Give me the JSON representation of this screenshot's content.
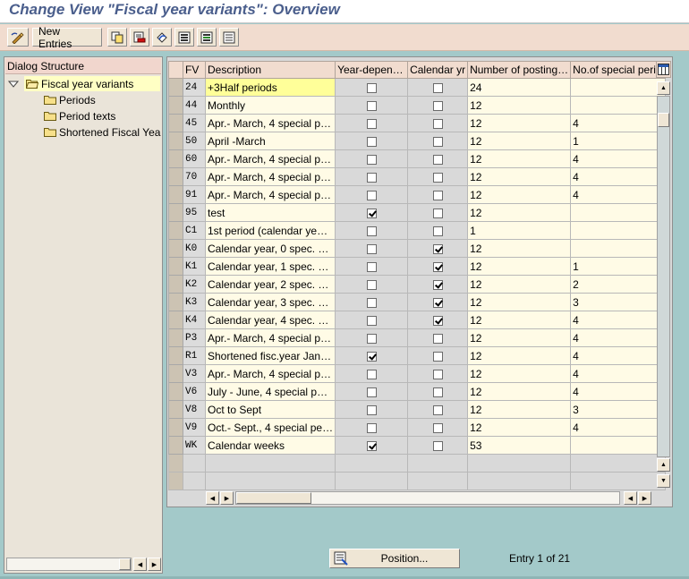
{
  "window": {
    "title": "Change View \"Fiscal year variants\": Overview"
  },
  "toolbar": {
    "buttons": [
      {
        "name": "display-change-icon"
      },
      {
        "name": "new-entries-button",
        "label": "New Entries"
      },
      {
        "name": "copy-icon"
      },
      {
        "name": "delete-icon"
      },
      {
        "name": "undo-icon"
      },
      {
        "name": "select-all-icon"
      },
      {
        "name": "select-block-icon"
      },
      {
        "name": "deselect-all-icon"
      }
    ]
  },
  "dialog_structure": {
    "header": "Dialog Structure",
    "items": [
      {
        "label": "Fiscal year variants",
        "level": 0,
        "selected": true,
        "expanded": true
      },
      {
        "label": "Periods",
        "level": 1
      },
      {
        "label": "Period texts",
        "level": 1
      },
      {
        "label": "Shortened Fiscal Yea",
        "level": 1
      }
    ]
  },
  "table": {
    "columns": [
      "FV",
      "Description",
      "Year-depen…",
      "Calendar yr",
      "Number of posting…",
      "No.of special perio"
    ],
    "rows": [
      {
        "fv": "24",
        "desc": "+3Half periods",
        "year_dep": false,
        "cal_yr": false,
        "posting": "24",
        "special": ""
      },
      {
        "fv": "44",
        "desc": "Monthly",
        "year_dep": false,
        "cal_yr": false,
        "posting": "12",
        "special": ""
      },
      {
        "fv": "45",
        "desc": "Apr.- March, 4 special p…",
        "year_dep": false,
        "cal_yr": false,
        "posting": "12",
        "special": "4"
      },
      {
        "fv": "50",
        "desc": "April -March",
        "year_dep": false,
        "cal_yr": false,
        "posting": "12",
        "special": "1"
      },
      {
        "fv": "60",
        "desc": "Apr.- March, 4 special p…",
        "year_dep": false,
        "cal_yr": false,
        "posting": "12",
        "special": "4"
      },
      {
        "fv": "70",
        "desc": "Apr.- March, 4 special p…",
        "year_dep": false,
        "cal_yr": false,
        "posting": "12",
        "special": "4"
      },
      {
        "fv": "91",
        "desc": "Apr.- March, 4 special p…",
        "year_dep": false,
        "cal_yr": false,
        "posting": "12",
        "special": "4"
      },
      {
        "fv": "95",
        "desc": "test",
        "year_dep": true,
        "cal_yr": false,
        "posting": "12",
        "special": ""
      },
      {
        "fv": "C1",
        "desc": "1st period (calendar ye…",
        "year_dep": false,
        "cal_yr": false,
        "posting": "1",
        "special": ""
      },
      {
        "fv": "K0",
        "desc": "Calendar year, 0 spec. …",
        "year_dep": false,
        "cal_yr": true,
        "posting": "12",
        "special": ""
      },
      {
        "fv": "K1",
        "desc": "Calendar year, 1 spec. …",
        "year_dep": false,
        "cal_yr": true,
        "posting": "12",
        "special": "1"
      },
      {
        "fv": "K2",
        "desc": "Calendar year, 2 spec. …",
        "year_dep": false,
        "cal_yr": true,
        "posting": "12",
        "special": "2"
      },
      {
        "fv": "K3",
        "desc": "Calendar year, 3 spec. …",
        "year_dep": false,
        "cal_yr": true,
        "posting": "12",
        "special": "3"
      },
      {
        "fv": "K4",
        "desc": "Calendar year, 4 spec. …",
        "year_dep": false,
        "cal_yr": true,
        "posting": "12",
        "special": "4"
      },
      {
        "fv": "P3",
        "desc": "Apr.- March, 4 special p…",
        "year_dep": false,
        "cal_yr": false,
        "posting": "12",
        "special": "4"
      },
      {
        "fv": "R1",
        "desc": "Shortened fisc.year Jan…",
        "year_dep": true,
        "cal_yr": false,
        "posting": "12",
        "special": "4"
      },
      {
        "fv": "V3",
        "desc": "Apr.- March, 4 special p…",
        "year_dep": false,
        "cal_yr": false,
        "posting": "12",
        "special": "4"
      },
      {
        "fv": "V6",
        "desc": "July - June, 4 special p…",
        "year_dep": false,
        "cal_yr": false,
        "posting": "12",
        "special": "4"
      },
      {
        "fv": "V8",
        "desc": "Oct to Sept",
        "year_dep": false,
        "cal_yr": false,
        "posting": "12",
        "special": "3"
      },
      {
        "fv": "V9",
        "desc": "Oct.- Sept., 4 special pe…",
        "year_dep": false,
        "cal_yr": false,
        "posting": "12",
        "special": "4"
      },
      {
        "fv": "WK",
        "desc": "Calendar weeks",
        "year_dep": true,
        "cal_yr": false,
        "posting": "53",
        "special": ""
      }
    ],
    "empty_rows": 2
  },
  "footer": {
    "position_label": "Position...",
    "entry_info": "Entry 1 of 21"
  },
  "colors": {
    "background": "#a3c9c9",
    "title": "#4a5e8c",
    "toolbar": "#f1dccf",
    "highlight_cell": "#ffff99"
  }
}
